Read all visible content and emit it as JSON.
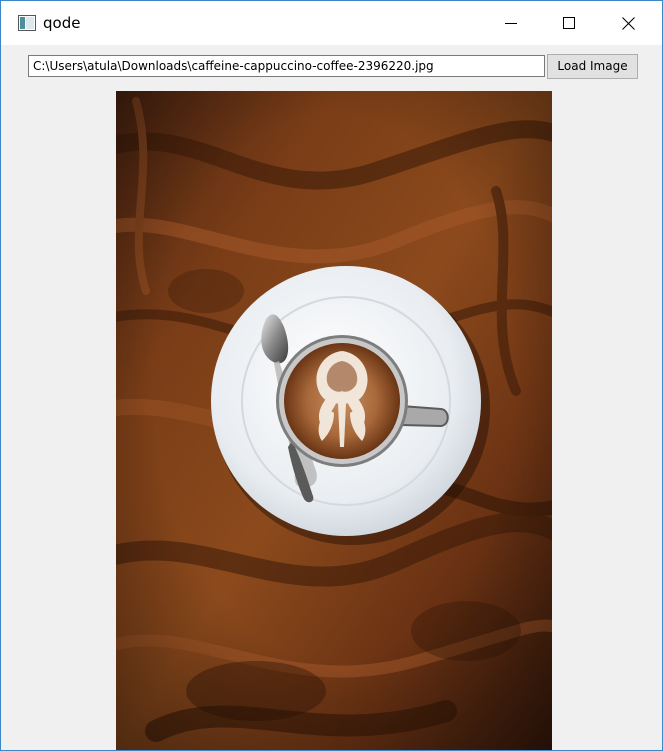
{
  "window": {
    "title": "qode",
    "icon": "app-window-icon",
    "controls": [
      "minimize-icon",
      "maximize-icon",
      "close-icon"
    ]
  },
  "toolbar": {
    "path_value": "C:\\Users\\atula\\Downloads\\caffeine-cappuccino-coffee-2396220.jpg",
    "load_label": "Load Image"
  },
  "image": {
    "subject": "cappuccino-on-wooden-table",
    "colors": {
      "wood": "#6b3412",
      "saucer": "#eef1f4",
      "crema": "#9a5a2e"
    }
  }
}
